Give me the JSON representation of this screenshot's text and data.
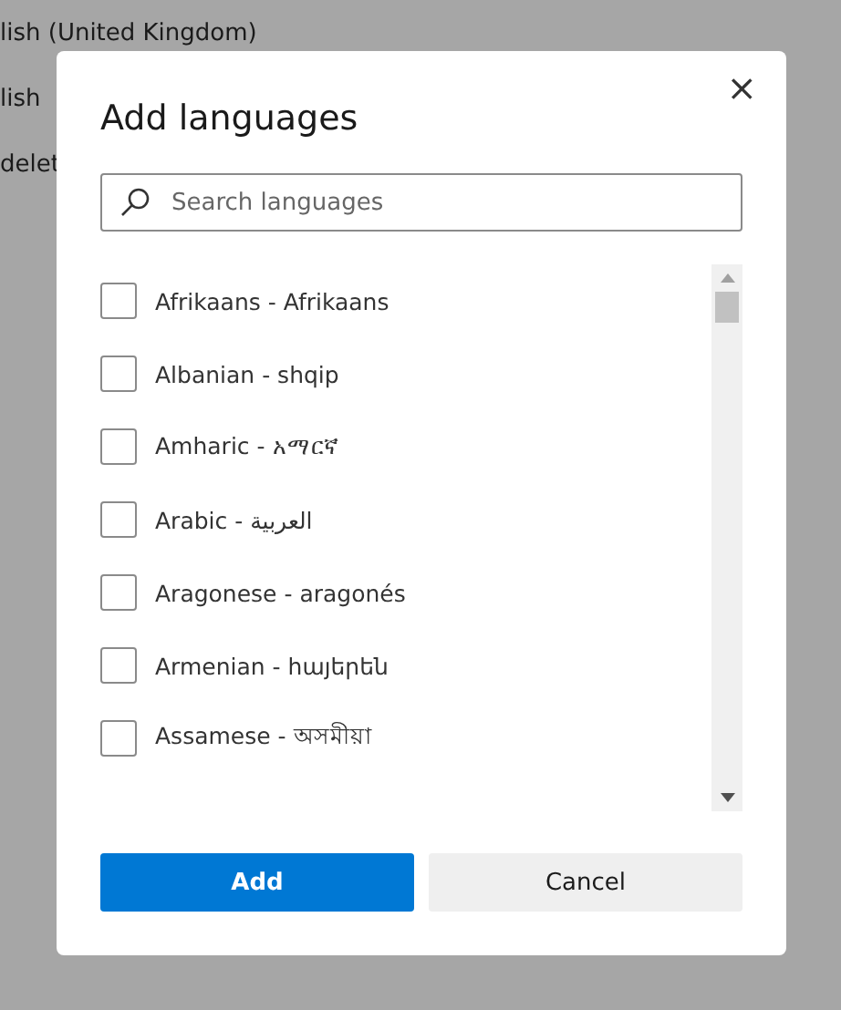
{
  "background": {
    "lines": [
      "lish (United Kingdom)",
      "lish",
      "delet"
    ]
  },
  "dialog": {
    "title": "Add languages",
    "close": "×",
    "search": {
      "placeholder": "Search languages"
    },
    "languages": [
      {
        "label": "Afrikaans - Afrikaans",
        "checked": false
      },
      {
        "label": "Albanian - shqip",
        "checked": false
      },
      {
        "label": "Amharic - አማርኛ",
        "checked": false
      },
      {
        "label": "Arabic - العربية",
        "checked": false
      },
      {
        "label": "Aragonese - aragonés",
        "checked": false
      },
      {
        "label": "Armenian - հայերեն",
        "checked": false
      },
      {
        "label": "Assamese - অসমীয়া",
        "checked": false
      }
    ],
    "buttons": [
      {
        "label": "Add",
        "kind": "primary"
      },
      {
        "label": "Cancel",
        "kind": "secondary"
      }
    ]
  }
}
